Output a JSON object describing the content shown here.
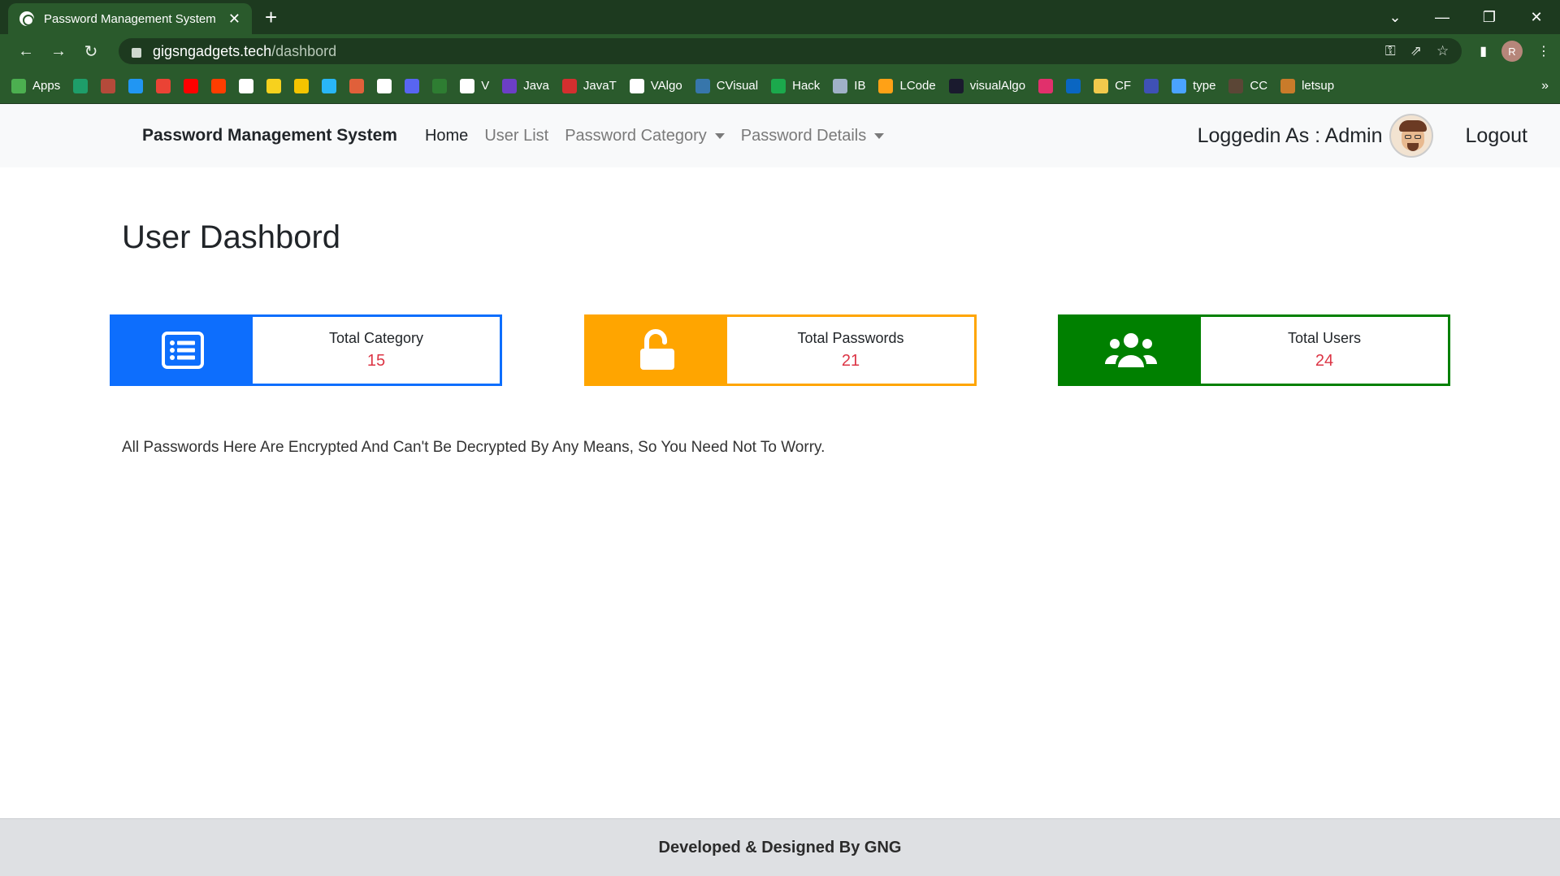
{
  "browser": {
    "tab_title": "Password Management System",
    "url_host": "gigsngadgets.tech",
    "url_path": "/dashbord",
    "profile_initial": "R",
    "bookmarks": [
      {
        "label": "Apps",
        "color": "#4caf50"
      },
      {
        "label": "",
        "color": "#1e9e6a"
      },
      {
        "label": "",
        "color": "#b44a3a"
      },
      {
        "label": "",
        "color": "#2196f3"
      },
      {
        "label": "",
        "color": "#ea4335"
      },
      {
        "label": "",
        "color": "#ff0000"
      },
      {
        "label": "",
        "color": "#ff3d00"
      },
      {
        "label": "",
        "color": "#ffffff"
      },
      {
        "label": "",
        "color": "#f7d11e"
      },
      {
        "label": "",
        "color": "#f5c400"
      },
      {
        "label": "",
        "color": "#29b6f6"
      },
      {
        "label": "",
        "color": "#e0603a"
      },
      {
        "label": "",
        "color": "#ffffff"
      },
      {
        "label": "",
        "color": "#5865f2"
      },
      {
        "label": "",
        "color": "#2e7d32"
      },
      {
        "label": "V",
        "color": "#ffffff"
      },
      {
        "label": "Java",
        "color": "#6c3fc5"
      },
      {
        "label": "JavaT",
        "color": "#d32f2f"
      },
      {
        "label": "VAlgo",
        "color": "#ffffff"
      },
      {
        "label": "CVisual",
        "color": "#3776ab"
      },
      {
        "label": "Hack",
        "color": "#1ba94c"
      },
      {
        "label": "IB",
        "color": "#9fb1c7"
      },
      {
        "label": "LCode",
        "color": "#ffa116"
      },
      {
        "label": "visualAlgo",
        "color": "#1a1a2e"
      },
      {
        "label": "",
        "color": "#e1306c"
      },
      {
        "label": "",
        "color": "#0a66c2"
      },
      {
        "label": "CF",
        "color": "#f2c94c"
      },
      {
        "label": "",
        "color": "#3f51b5"
      },
      {
        "label": "type",
        "color": "#4aa3ff"
      },
      {
        "label": "CC",
        "color": "#5b4636"
      },
      {
        "label": "letsup",
        "color": "#c97b2a"
      }
    ],
    "more_label": "»"
  },
  "navbar": {
    "brand": "Password Management System",
    "links": {
      "home": "Home",
      "user_list": "User List",
      "password_category": "Password Category",
      "password_details": "Password Details"
    },
    "logged_in": "Loggedin As : Admin",
    "logout": "Logout"
  },
  "main": {
    "title": "User Dashbord",
    "cards": [
      {
        "label": "Total Category",
        "value": "15",
        "color": "#0d6efd",
        "icon": "list-icon"
      },
      {
        "label": "Total Passwords",
        "value": "21",
        "color": "#ffa500",
        "icon": "unlock-icon"
      },
      {
        "label": "Total Users",
        "value": "24",
        "color": "#008000",
        "icon": "users-icon"
      }
    ],
    "note": "All Passwords Here Are Encrypted And Can't Be Decrypted By Any Means, So You Need Not To Worry."
  },
  "footer": {
    "text": "Developed & Designed By GNG"
  }
}
